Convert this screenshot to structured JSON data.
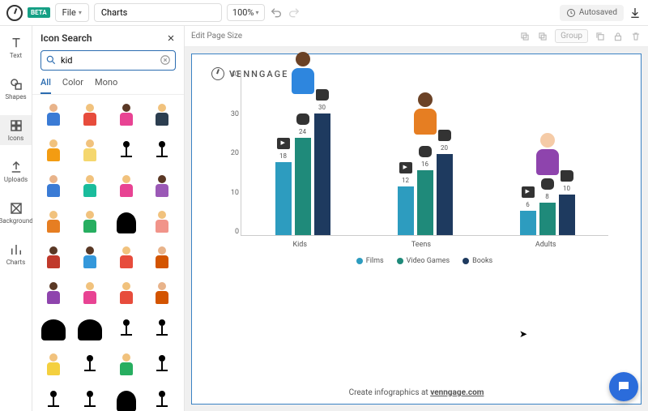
{
  "top": {
    "beta": "BETA",
    "file": "File",
    "doc_name": "Charts",
    "zoom": "100%",
    "autosaved": "Autosaved"
  },
  "rail": {
    "text": "Text",
    "shapes": "Shapes",
    "icons": "Icons",
    "uploads": "Uploads",
    "background": "Background",
    "charts": "Charts"
  },
  "panel": {
    "title": "Icon Search",
    "search_value": "kid",
    "tabs": {
      "all": "All",
      "color": "Color",
      "mono": "Mono"
    }
  },
  "icon_palette": [
    {
      "skin": "#e8b38a",
      "top": "#3a7bd5"
    },
    {
      "skin": "#f1c27d",
      "top": "#e74c3c"
    },
    {
      "skin": "#5a3825",
      "top": "#e84393"
    },
    {
      "skin": "#f1c27d",
      "top": "#2c3e50"
    },
    {
      "skin": "#f1c27d",
      "top": "#f39c12"
    },
    {
      "skin": "#f1c27d",
      "top": "#f5d76e"
    },
    {
      "type": "stick"
    },
    {
      "type": "stick"
    },
    {
      "skin": "#e8b38a",
      "top": "#3a7bd5"
    },
    {
      "skin": "#f1c27d",
      "top": "#1abc9c"
    },
    {
      "skin": "#f1c27d",
      "top": "#e84393"
    },
    {
      "skin": "#5a3825",
      "top": "#9b59b6"
    },
    {
      "skin": "#f1c27d",
      "top": "#e67e22"
    },
    {
      "skin": "#f1c27d",
      "top": "#27ae60"
    },
    {
      "type": "silh"
    },
    {
      "skin": "#f1c27d",
      "top": "#f1948a"
    },
    {
      "skin": "#5a3825",
      "top": "#c0392b"
    },
    {
      "skin": "#5a3825",
      "top": "#3498db"
    },
    {
      "skin": "#f1c27d",
      "top": "#e74c3c"
    },
    {
      "skin": "#e8b38a",
      "top": "#d35400"
    },
    {
      "skin": "#5a3825",
      "top": "#8e44ad"
    },
    {
      "skin": "#f1c27d",
      "top": "#e84393"
    },
    {
      "skin": "#f1c27d",
      "top": "#e74c3c"
    },
    {
      "skin": "#e8b38a",
      "top": "#d35400"
    },
    {
      "type": "silh",
      "cls": "fam"
    },
    {
      "type": "silh",
      "cls": "fam"
    },
    {
      "type": "stick"
    },
    {
      "type": "stick"
    },
    {
      "skin": "#f1c27d",
      "top": "#f4d03f"
    },
    {
      "type": "stick"
    },
    {
      "skin": "#f1c27d",
      "top": "#27ae60"
    },
    {
      "type": "stick"
    },
    {
      "type": "stick"
    },
    {
      "type": "stick"
    },
    {
      "type": "silh"
    },
    {
      "type": "stick"
    }
  ],
  "subtoolbar": {
    "edit_page": "Edit Page Size",
    "group": "Group"
  },
  "canvas": {
    "brand": "VENNGAGE",
    "footer_a": "Create infographics at ",
    "footer_b": "venngage.com"
  },
  "chart_data": {
    "type": "bar",
    "categories": [
      "Kids",
      "Teens",
      "Adults"
    ],
    "series": [
      {
        "name": "Films",
        "color": "#2d9cbf",
        "values": [
          18,
          12,
          6
        ]
      },
      {
        "name": "Video Games",
        "color": "#1f8a7a",
        "values": [
          24,
          16,
          8
        ]
      },
      {
        "name": "Books",
        "color": "#1e3a5f",
        "values": [
          30,
          20,
          10
        ]
      }
    ],
    "ylim": [
      0,
      40
    ],
    "yticks": [
      0,
      10,
      20,
      30,
      40
    ],
    "avatars": [
      {
        "skin": "#6b4226",
        "top": "#2e86de"
      },
      {
        "skin": "#6b4226",
        "top": "#e67e22"
      },
      {
        "skin": "#f5cba7",
        "top": "#8e44ad"
      }
    ]
  }
}
